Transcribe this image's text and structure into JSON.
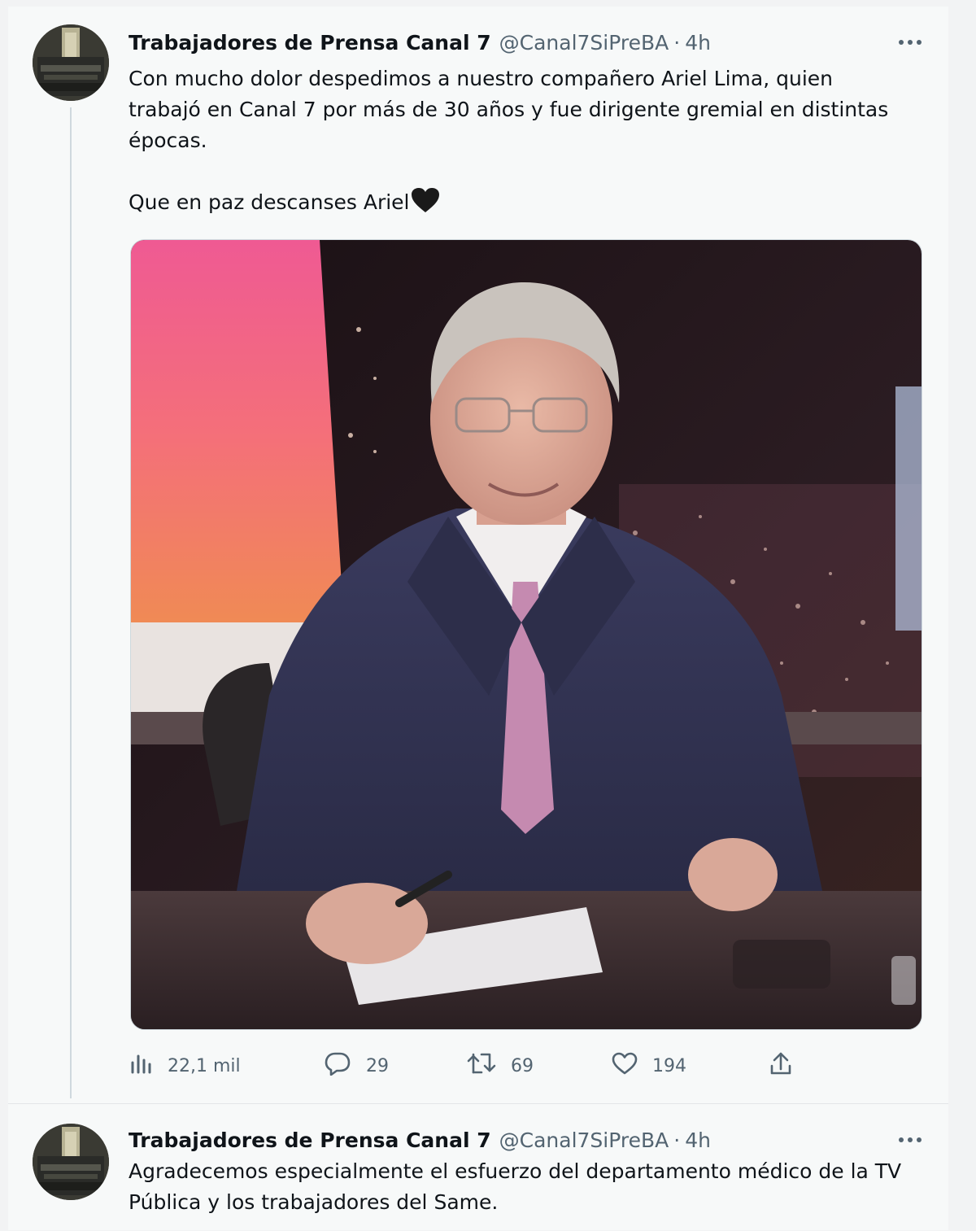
{
  "tweets": [
    {
      "author_name": "Trabajadores de Prensa Canal 7",
      "handle": "@Canal7SiPreBA",
      "separator": "·",
      "time": "4h",
      "text": "Con mucho dolor despedimos a nuestro compañero Ariel Lima, quien\ntrabajó en Canal 7 por más de 30 años y fue dirigente gremial en distintas\népocas.\n\nQue en paz descanses Ariel",
      "emoji": "black-heart",
      "stats": {
        "views": "22,1 mil",
        "replies": "29",
        "retweets": "69",
        "likes": "194"
      },
      "icons": {
        "views": "views-icon",
        "reply": "reply-icon",
        "retweet": "retweet-icon",
        "like": "like-icon",
        "share": "share-icon",
        "more": "more-options-icon"
      }
    },
    {
      "author_name": "Trabajadores de Prensa Canal 7",
      "handle": "@Canal7SiPreBA",
      "separator": "·",
      "time": "4h",
      "text": "Agradecemos especialmente el esfuerzo del departamento médico de la TV\nPública y los trabajadores del Same."
    }
  ],
  "colors": {
    "background": "#f7f9f9",
    "text": "#0f1419",
    "muted": "#536471"
  }
}
